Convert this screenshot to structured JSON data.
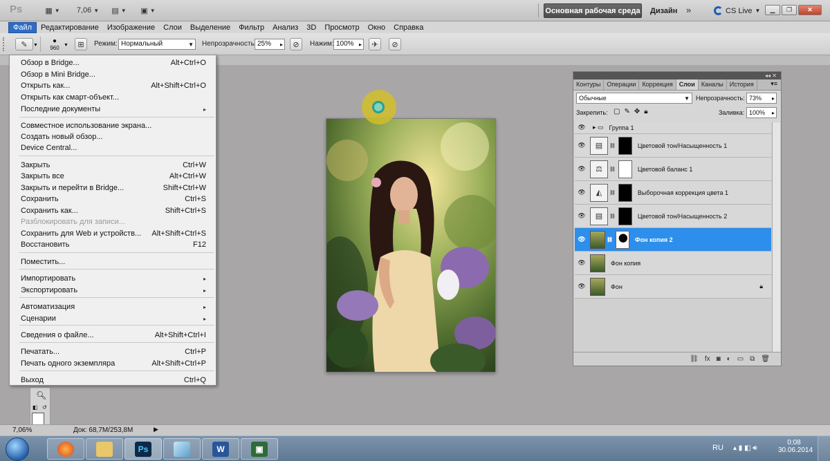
{
  "app": {
    "logo": "Ps",
    "zoom_value": "7,06",
    "workspace_button": "Основная рабочая среда",
    "design_label": "Дизайн",
    "more_workspaces": "»",
    "cs_live": "CS Live"
  },
  "menubar": [
    "Файл",
    "Редактирование",
    "Изображение",
    "Слои",
    "Выделение",
    "Фильтр",
    "Анализ",
    "3D",
    "Просмотр",
    "Окно",
    "Справка"
  ],
  "options": {
    "brush_size": "960",
    "mode_label": "Режим:",
    "mode_value": "Нормальный",
    "opacity_label": "Непрозрачность:",
    "opacity_value": "25%",
    "flow_label": "Нажим:",
    "flow_value": "100%"
  },
  "file_menu": [
    {
      "label": "Обзор в Bridge...",
      "shortcut": "Alt+Ctrl+O"
    },
    {
      "label": "Обзор в Mini Bridge...",
      "shortcut": ""
    },
    {
      "label": "Открыть как...",
      "shortcut": "Alt+Shift+Ctrl+O"
    },
    {
      "label": "Открыть как смарт-объект...",
      "shortcut": ""
    },
    {
      "label": "Последние документы",
      "shortcut": "▸"
    },
    {
      "label": "Совместное использование экрана...",
      "shortcut": ""
    },
    {
      "label": "Создать новый обзор...",
      "shortcut": ""
    },
    {
      "label": "Device Central...",
      "shortcut": ""
    },
    {
      "label": "Закрыть",
      "shortcut": "Ctrl+W"
    },
    {
      "label": "Закрыть все",
      "shortcut": "Alt+Ctrl+W"
    },
    {
      "label": "Закрыть и перейти в Bridge...",
      "shortcut": "Shift+Ctrl+W"
    },
    {
      "label": "Сохранить",
      "shortcut": "Ctrl+S"
    },
    {
      "label": "Сохранить как...",
      "shortcut": "Shift+Ctrl+S"
    },
    {
      "label": "Разблокировать для записи...",
      "shortcut": ""
    },
    {
      "label": "Сохранить для Web и устройств...",
      "shortcut": "Alt+Shift+Ctrl+S"
    },
    {
      "label": "Восстановить",
      "shortcut": "F12"
    },
    {
      "label": "Поместить...",
      "shortcut": ""
    },
    {
      "label": "Импортировать",
      "shortcut": "▸"
    },
    {
      "label": "Экспортировать",
      "shortcut": "▸"
    },
    {
      "label": "Автоматизация",
      "shortcut": "▸"
    },
    {
      "label": "Сценарии",
      "shortcut": "▸"
    },
    {
      "label": "Сведения о файле...",
      "shortcut": "Alt+Shift+Ctrl+I"
    },
    {
      "label": "Печатать...",
      "shortcut": "Ctrl+P"
    },
    {
      "label": "Печать одного экземпляра",
      "shortcut": "Alt+Shift+Ctrl+P"
    },
    {
      "label": "Выход",
      "shortcut": "Ctrl+Q"
    }
  ],
  "panel": {
    "collapse": "◂◂ ✕",
    "tabs": [
      "Контуры",
      "Операции",
      "Коррекция",
      "Слои",
      "Каналы",
      "История"
    ],
    "blend_mode": "Обычные",
    "opacity_label": "Непрозрачность:",
    "opacity_value": "73%",
    "lock_label": "Закрепить:",
    "fill_label": "Заливка:",
    "fill_value": "100%",
    "layers": [
      "Группа 1",
      "Цветовой тон/Насыщенность 1",
      "Цветовой баланс 1",
      "Выборочная коррекция цвета 1",
      "Цветовой тон/Насыщенность 2",
      "Фон копия 2",
      "Фон копия",
      "Фон"
    ]
  },
  "status": {
    "zoom": "7,06%",
    "doc": "Док: 68,7M/253,8M"
  },
  "taskbar": {
    "lang": "RU",
    "time": "0:08",
    "date": "30.06.2014"
  }
}
